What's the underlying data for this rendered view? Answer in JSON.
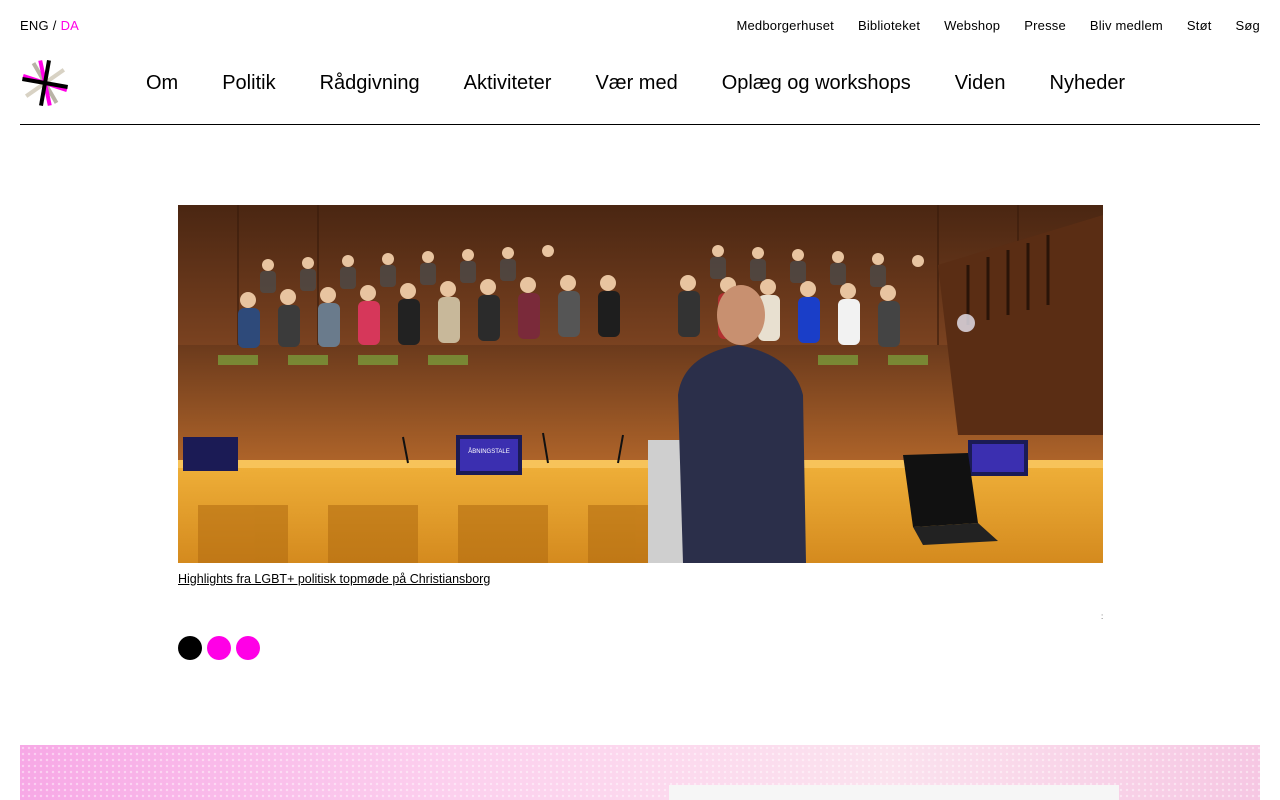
{
  "language": {
    "eng": "ENG",
    "separator": "/",
    "da": "DA"
  },
  "utility_nav": [
    "Medborgerhuset",
    "Biblioteket",
    "Webshop",
    "Presse",
    "Bliv medlem",
    "Støt",
    "Søg"
  ],
  "main_nav": [
    "Om",
    "Politik",
    "Rådgivning",
    "Aktiviteter",
    "Vær med",
    "Oplæg og workshops",
    "Viden",
    "Nyheder"
  ],
  "hero": {
    "caption": "Highlights fra LGBT+ politisk topmøde på Christiansborg",
    "screen_label": "ÅBNINGSTALE",
    "corner_mark": ":"
  },
  "slider": {
    "slide_count": 3,
    "active_index": 0
  },
  "colors": {
    "accent": "#ff00e6",
    "text": "#000000",
    "background": "#ffffff"
  }
}
